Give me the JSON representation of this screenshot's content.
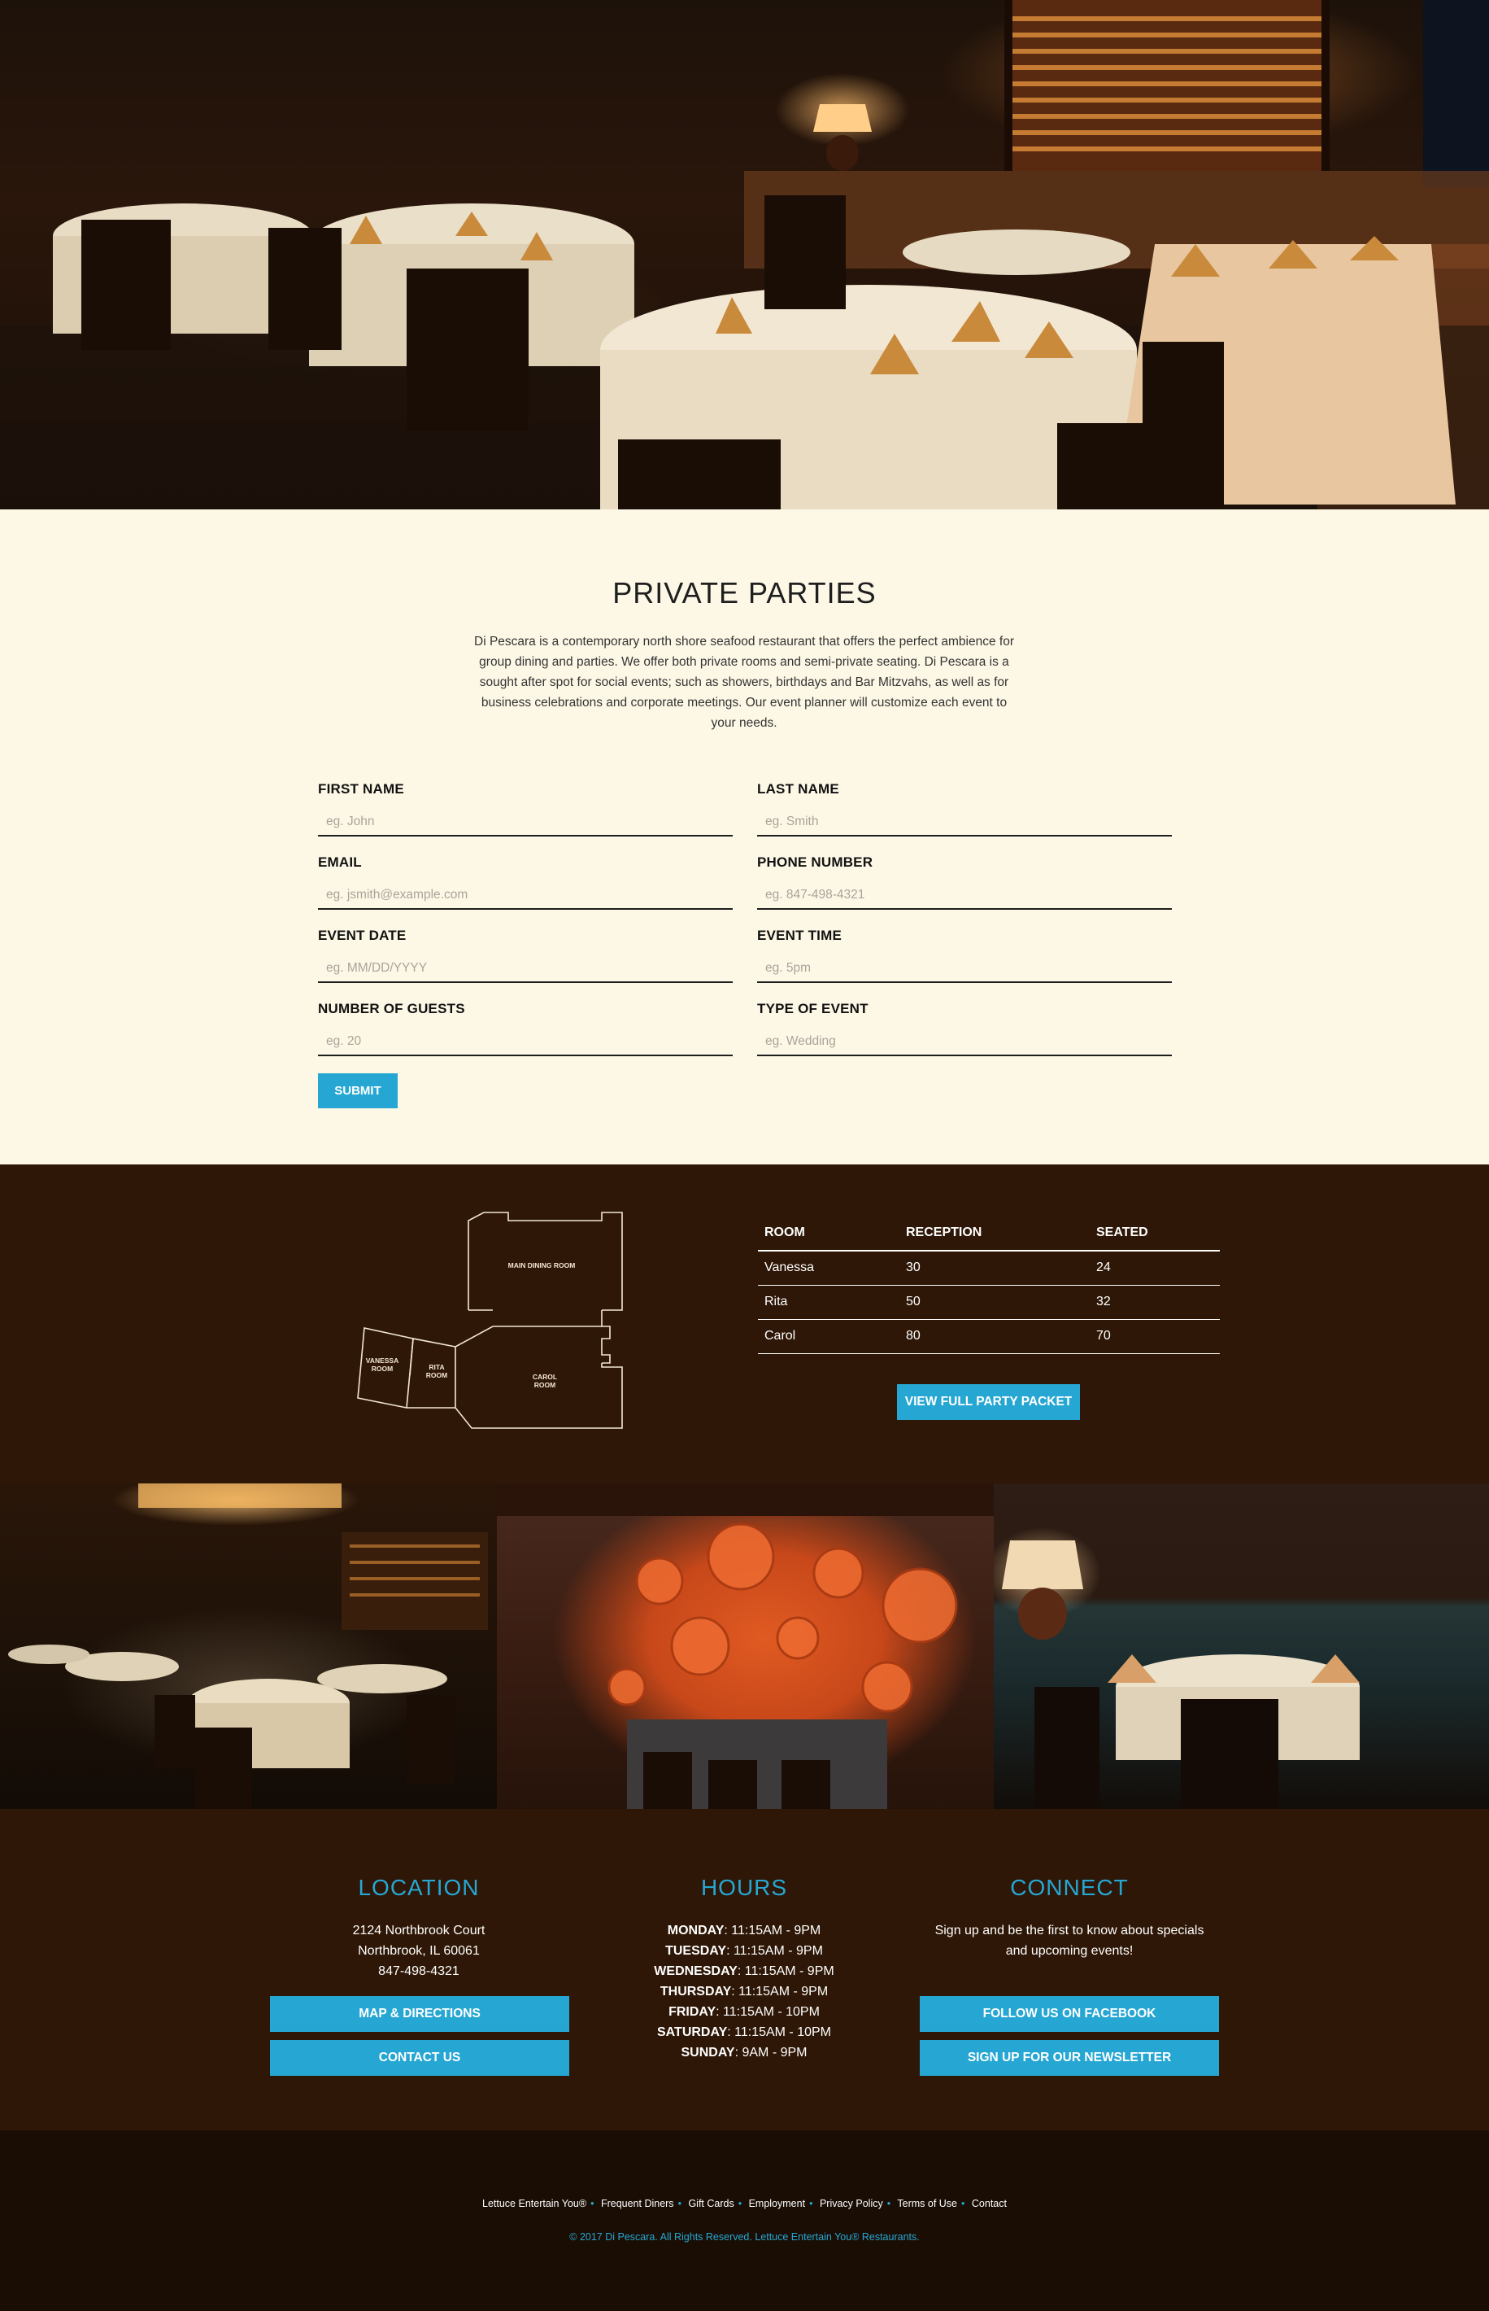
{
  "parties": {
    "title": "PRIVATE PARTIES",
    "intro": "Di Pescara is a contemporary north shore seafood restaurant that offers the perfect ambience for group dining and parties. We offer both private rooms and semi-private seating. Di Pescara is a sought after spot for social events; such as showers, birthdays and Bar Mitzvahs, as well as for business celebrations and corporate meetings. Our event planner will customize each event to your needs."
  },
  "form": {
    "first_name": {
      "label": "FIRST NAME",
      "placeholder": "eg. John"
    },
    "last_name": {
      "label": "LAST NAME",
      "placeholder": "eg. Smith"
    },
    "email": {
      "label": "EMAIL",
      "placeholder": "eg. jsmith@example.com"
    },
    "phone": {
      "label": "PHONE NUMBER",
      "placeholder": "eg. 847-498-4321"
    },
    "event_date": {
      "label": "EVENT DATE",
      "placeholder": "eg. MM/DD/YYYY"
    },
    "event_time": {
      "label": "EVENT TIME",
      "placeholder": "eg. 5pm"
    },
    "guests": {
      "label": "NUMBER OF GUESTS",
      "placeholder": "eg. 20"
    },
    "event_type": {
      "label": "TYPE OF EVENT",
      "placeholder": "eg. Wedding"
    },
    "submit_label": "SUBMIT"
  },
  "floorplan": {
    "main": "MAIN DINING ROOM",
    "vanessa": [
      "VANESSA",
      "ROOM"
    ],
    "rita": [
      "RITA",
      "ROOM"
    ],
    "carol": [
      "CAROL",
      "ROOM"
    ]
  },
  "rooms": {
    "headers": [
      "ROOM",
      "RECEPTION",
      "SEATED"
    ],
    "rows": [
      [
        "Vanessa",
        "30",
        "24"
      ],
      [
        "Rita",
        "50",
        "32"
      ],
      [
        "Carol",
        "80",
        "70"
      ]
    ],
    "packet_label": "VIEW FULL PARTY PACKET"
  },
  "location": {
    "title": "LOCATION",
    "address1": "2124 Northbrook Court",
    "address2": "Northbrook, IL 60061",
    "phone": "847-498-4321",
    "map_label": "MAP & DIRECTIONS",
    "contact_label": "CONTACT US"
  },
  "hours": {
    "title": "HOURS",
    "lines": [
      {
        "day": "MONDAY",
        "time": ": 11:15AM - 9PM"
      },
      {
        "day": "TUESDAY",
        "time": ": 11:15AM - 9PM"
      },
      {
        "day": "WEDNESDAY",
        "time": ": 11:15AM - 9PM"
      },
      {
        "day": "THURSDAY",
        "time": ": 11:15AM - 9PM"
      },
      {
        "day": "FRIDAY",
        "time": ": 11:15AM - 10PM"
      },
      {
        "day": "SATURDAY",
        "time": ": 11:15AM - 10PM"
      },
      {
        "day": "SUNDAY",
        "time": ": 9AM - 9PM"
      }
    ]
  },
  "connect": {
    "title": "CONNECT",
    "text": "Sign up and be the first to know about specials and upcoming events!",
    "facebook_label": "FOLLOW US ON FACEBOOK",
    "newsletter_label": "SIGN UP FOR OUR NEWSLETTER"
  },
  "footer": {
    "links": [
      "Lettuce Entertain You®",
      "Frequent Diners",
      "Gift Cards",
      "Employment",
      "Privacy Policy",
      "Terms of Use",
      "Contact"
    ],
    "separator": "•",
    "copyright": "© 2017 Di Pescara. All Rights Reserved. Lettuce Entertain You® Restaurants."
  },
  "colors": {
    "accent": "#26a7d3",
    "cream": "#fdf8e6",
    "brown": "#2e1706",
    "footer": "#1a0d04"
  }
}
